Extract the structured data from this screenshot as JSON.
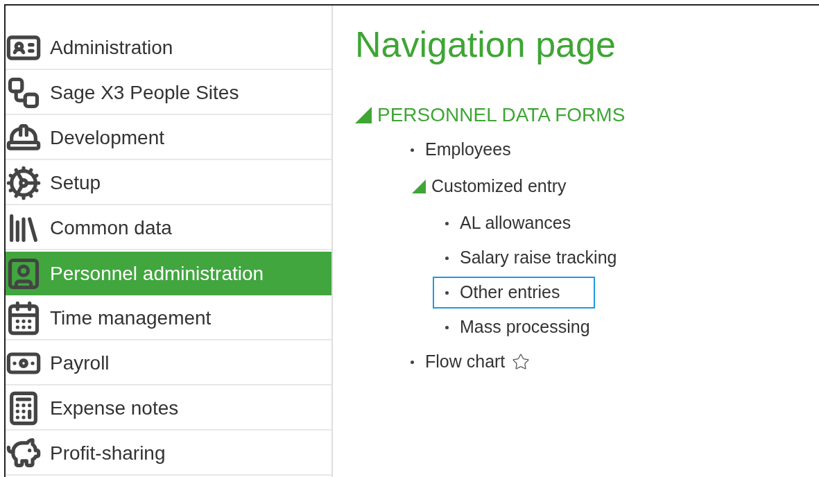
{
  "sidebar": {
    "items": [
      {
        "label": "Administration",
        "selected": false
      },
      {
        "label": "Sage X3 People Sites",
        "selected": false
      },
      {
        "label": "Development",
        "selected": false
      },
      {
        "label": "Setup",
        "selected": false
      },
      {
        "label": "Common data",
        "selected": false
      },
      {
        "label": "Personnel administration",
        "selected": true
      },
      {
        "label": "Time management",
        "selected": false
      },
      {
        "label": "Payroll",
        "selected": false
      },
      {
        "label": "Expense notes",
        "selected": false
      },
      {
        "label": "Profit-sharing",
        "selected": false
      }
    ]
  },
  "page": {
    "title": "Navigation page",
    "section": {
      "label": "PERSONNEL DATA FORMS",
      "expanded": true,
      "children": [
        {
          "label": "Employees",
          "selected": false
        },
        {
          "label": "Customized entry",
          "expanded": true,
          "children": [
            {
              "label": "AL allowances",
              "selected": false
            },
            {
              "label": "Salary raise tracking",
              "selected": false
            },
            {
              "label": "Other entries",
              "selected": true
            },
            {
              "label": "Mass processing",
              "selected": false
            }
          ]
        },
        {
          "label": "Flow chart",
          "selected": false,
          "favorite": false
        }
      ]
    }
  }
}
